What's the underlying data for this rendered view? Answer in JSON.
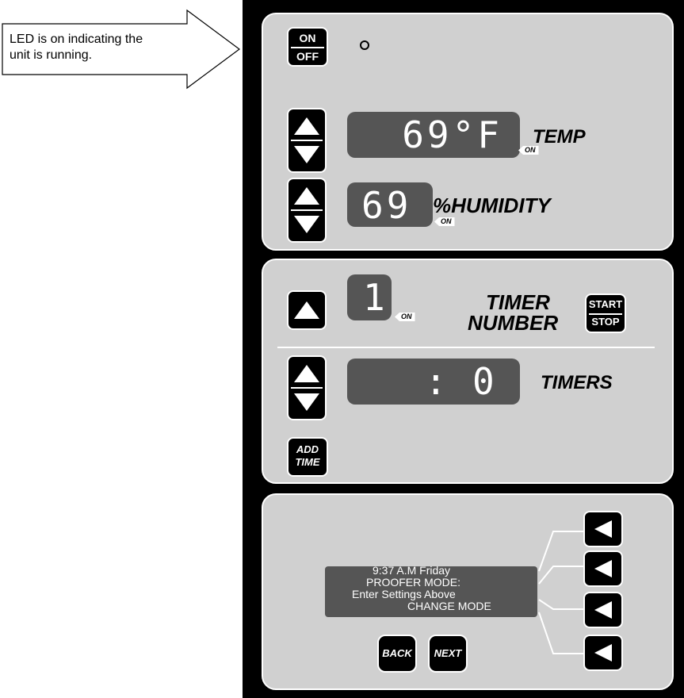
{
  "callout": {
    "line1": "LED is on indicating the",
    "line2": "unit is running."
  },
  "power": {
    "on_label": "ON",
    "off_label": "OFF"
  },
  "temperature": {
    "display": "69°F",
    "indicator": "ON",
    "label": "TEMP"
  },
  "humidity": {
    "display": "69",
    "indicator": "ON",
    "label": "%HUMIDITY"
  },
  "timer_number": {
    "display": "1",
    "indicator": "ON",
    "label_line1": "TIMER",
    "label_line2": "NUMBER",
    "start_label": "START",
    "stop_label": "STOP"
  },
  "timers": {
    "colon": ":",
    "value": "0",
    "label": "TIMERS",
    "add_line1": "ADD",
    "add_line2": "TIME"
  },
  "lcd": {
    "line1": "9:37 A.M Friday",
    "line2": "PROOFER MODE:",
    "line3": "Enter Settings Above",
    "line4": "CHANGE MODE"
  },
  "nav": {
    "back": "BACK",
    "next": "NEXT"
  },
  "colors": {
    "panel": "#d0d0d0",
    "display_bg": "#555555",
    "body": "#000000"
  },
  "icons": {
    "up": "up-arrow-icon",
    "down": "down-arrow-icon",
    "left": "left-arrow-icon"
  }
}
